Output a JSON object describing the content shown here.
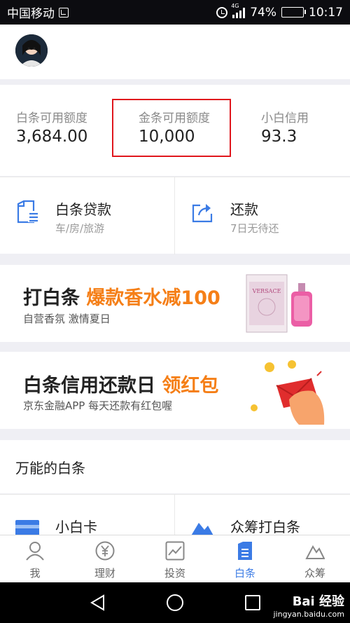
{
  "status_bar": {
    "carrier": "中国移动",
    "network": "4G",
    "battery": "74%",
    "battery_level": 0.74,
    "time": "10:17"
  },
  "credit": {
    "items": [
      {
        "label": "白条可用额度",
        "value": "3,684.00"
      },
      {
        "label": "金条可用额度",
        "value": "10,000"
      },
      {
        "label": "小白信用",
        "value": "93.3"
      }
    ],
    "highlight_color": "#e0161d"
  },
  "services": [
    {
      "title": "白条贷款",
      "sub": "车/房/旅游",
      "icon": "document-icon"
    },
    {
      "title": "还款",
      "sub": "7日无待还",
      "icon": "share-icon"
    }
  ],
  "banners": [
    {
      "headline": "打白条 ",
      "highlight": "爆款香水减100",
      "tagline": "自营香氛 激情夏日",
      "image_text": "VERSACE"
    },
    {
      "headline": "白条信用还款日 ",
      "highlight": "领红包",
      "tagline": "京东金融APP  每天还款有红包喔"
    }
  ],
  "section": {
    "title": "万能的白条",
    "items": [
      {
        "title": "小白卡",
        "icon": "card-icon"
      },
      {
        "title": "众筹打白条",
        "icon": "mountain-icon"
      }
    ]
  },
  "tabs": [
    {
      "label": "我",
      "icon": "person-icon"
    },
    {
      "label": "理财",
      "icon": "yen-icon"
    },
    {
      "label": "投资",
      "icon": "chart-icon"
    },
    {
      "label": "白条",
      "icon": "ious-icon",
      "active": true
    },
    {
      "label": "众筹",
      "icon": "mountain-icon"
    }
  ],
  "watermark": {
    "brand": "Bai 经验",
    "url": "jingyan.baidu.com"
  },
  "colors": {
    "accent": "#3b7be5",
    "orange": "#f57f17",
    "highlight": "#e0161d"
  }
}
